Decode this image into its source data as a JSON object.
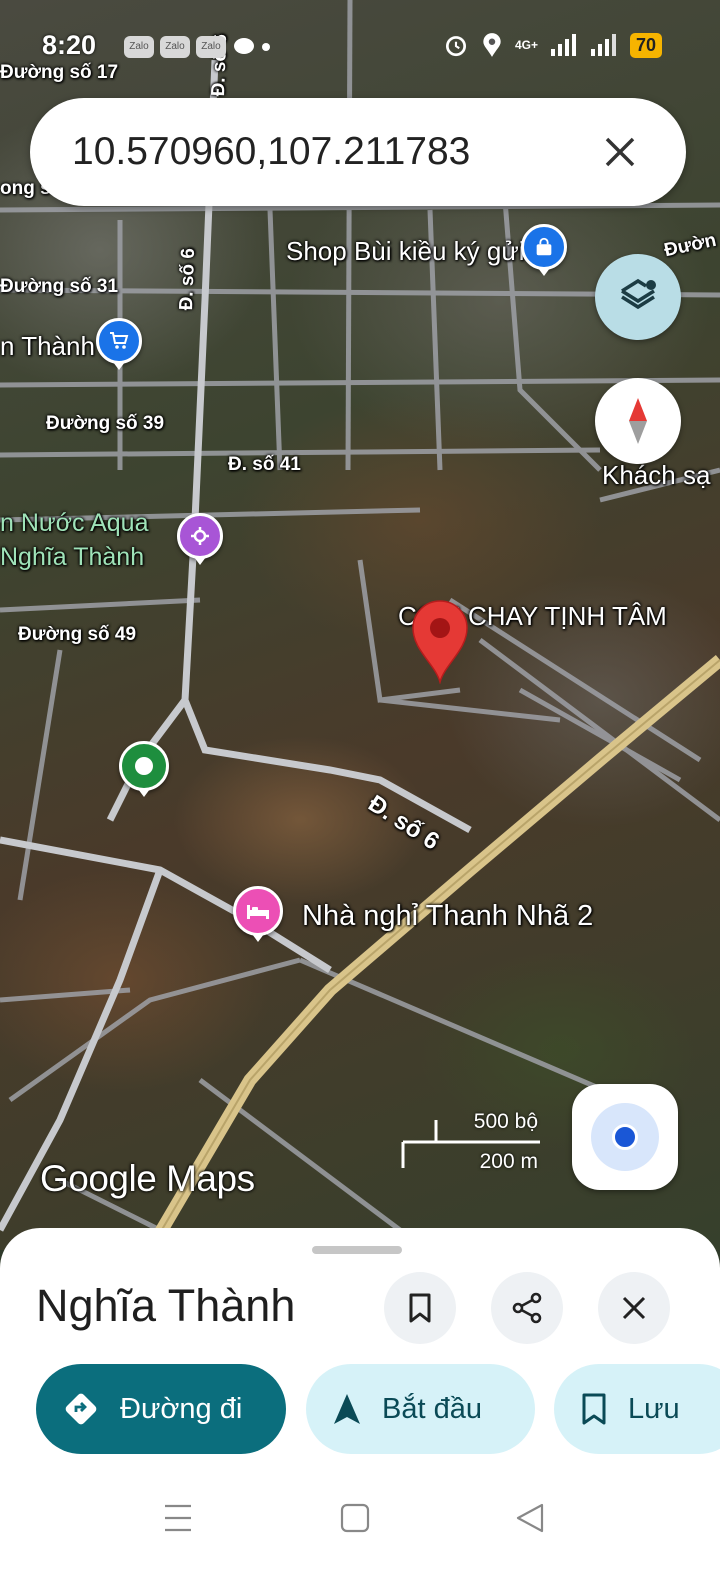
{
  "status_bar": {
    "time": "8:20",
    "app_icons": [
      "Zalo",
      "Zalo",
      "Zalo"
    ],
    "network": "4G+",
    "battery": "70"
  },
  "search": {
    "query": "10.570960,107.211783"
  },
  "map": {
    "labels": {
      "duong_so_17": "Đường số 17",
      "duong_so_31": "Đường số 31",
      "duong_so_39": "Đường số 39",
      "d_so_41": "Đ. số 41",
      "duong_so_49": "Đường số 49",
      "d_so_6_vertical": "Đ. số 6",
      "d_so_6_top": "Đ. số 6",
      "d_so_6_diag": "Đ. số 6",
      "duong_right": "Đườn",
      "ong_left": "ong s",
      "thanh_left": "n Thành",
      "khach_san": "Khách sạ"
    },
    "places": {
      "shop": "Shop Bùi kiều ký gửi",
      "nuoc_aqua_line1": "n Nước Aqua",
      "nuoc_aqua_line2": "Nghĩa Thành",
      "com_chay": "CƠM CHAY TỊNH TÂM",
      "nha_nghi": "Nhà nghỉ Thanh Nhã 2"
    },
    "scale": {
      "imperial": "500 bộ",
      "metric": "200 m"
    },
    "attribution": "Google Maps",
    "colors": {
      "pin_red": "#e53935",
      "shop_pin": "#1a73e8",
      "purple_pin": "#a855d6",
      "green_pin": "#1e8e3e",
      "hotel_pin": "#ec4fb5",
      "highway": "#d9c48a"
    }
  },
  "sheet": {
    "place_title": "Nghĩa Thành",
    "buttons": {
      "directions": "Đường đi",
      "start": "Bắt đầu",
      "save": "Lưu"
    },
    "icons": [
      "bookmark-icon",
      "share-icon",
      "close-icon"
    ],
    "colors": {
      "primary": "#0b6e7d",
      "secondary_bg": "#d6f2f8"
    }
  }
}
